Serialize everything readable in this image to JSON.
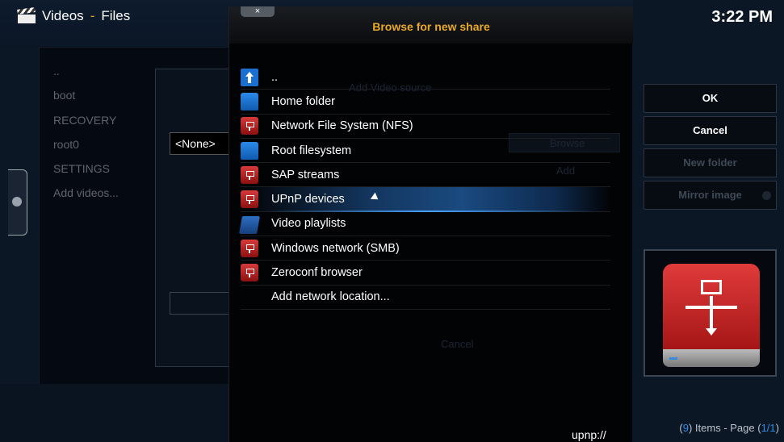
{
  "header": {
    "section": "Videos",
    "separator": "-",
    "subsection": "Files",
    "clock": "3:22 PM"
  },
  "background": {
    "file_list": [
      "..",
      "boot",
      "RECOVERY",
      "root0",
      "SETTINGS",
      "Add videos..."
    ],
    "source_label": "<None>",
    "ghost_title": "Add Video source",
    "ghost_browse": "Browse",
    "ghost_add": "Add",
    "ghost_cancel": "Cancel"
  },
  "dialog": {
    "close_label": "×",
    "title": "Browse for new share",
    "items": [
      {
        "label": "..",
        "icon": "parent-folder-icon"
      },
      {
        "label": "Home folder",
        "icon": "home-folder-icon"
      },
      {
        "label": "Network File System (NFS)",
        "icon": "network-drive-icon"
      },
      {
        "label": "Root filesystem",
        "icon": "drive-icon"
      },
      {
        "label": "SAP streams",
        "icon": "network-drive-icon"
      },
      {
        "label": "UPnP devices",
        "icon": "network-drive-icon",
        "selected": true
      },
      {
        "label": "Video playlists",
        "icon": "folder-icon"
      },
      {
        "label": "Windows network (SMB)",
        "icon": "network-drive-icon"
      },
      {
        "label": "Zeroconf browser",
        "icon": "network-drive-icon"
      },
      {
        "label": "Add network location...",
        "icon": ""
      }
    ],
    "current_path": "upnp://"
  },
  "side_panel": {
    "ok_label": "OK",
    "cancel_label": "Cancel",
    "new_folder_label": "New folder",
    "mirror_label": "Mirror image",
    "items_count": "9",
    "items_text": " Items - Page ",
    "page": "1/1"
  },
  "colors": {
    "accent": "#e8a92a",
    "highlight": "#2f8fe8",
    "network_drive": "#c62828"
  }
}
